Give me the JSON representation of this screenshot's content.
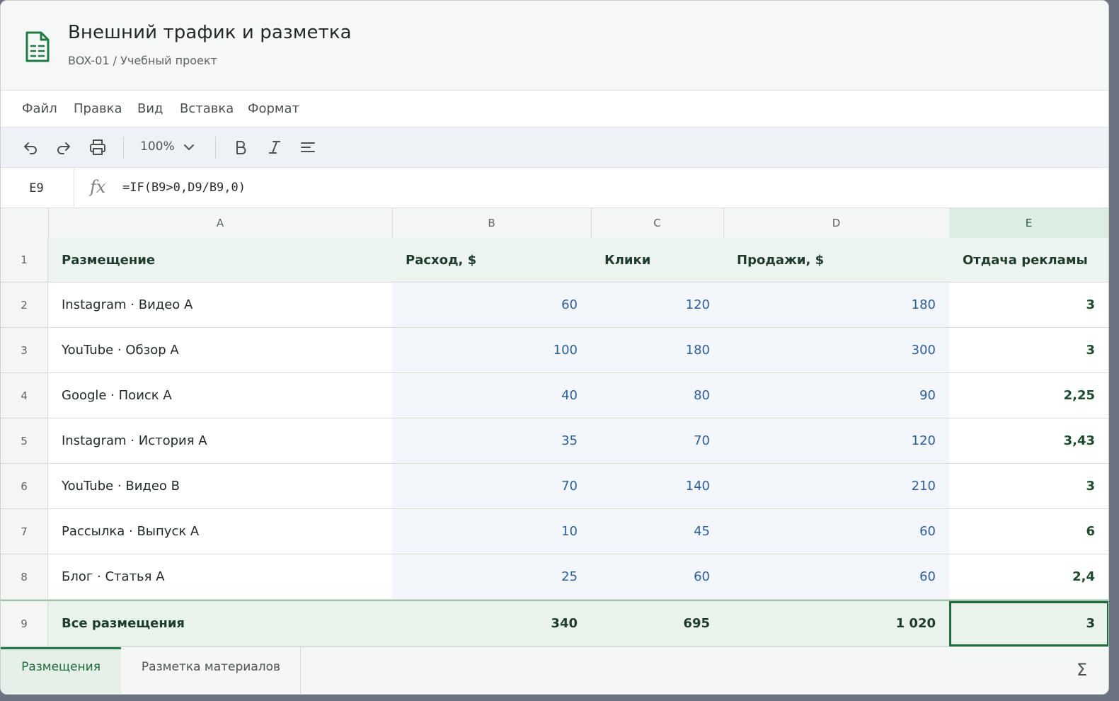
{
  "document": {
    "title": "Внешний трафик и разметка",
    "path": "BOX-01 / Учебный проект",
    "icon": "spreadsheet-doc-icon"
  },
  "menu": [
    "Файл",
    "Правка",
    "Вид",
    "Вставка",
    "Формат"
  ],
  "toolbar": {
    "zoom": "100%",
    "icons": [
      "undo-icon",
      "redo-icon",
      "print-icon",
      "chevron-down-icon",
      "bold-icon",
      "italic-icon",
      "align-icon"
    ]
  },
  "formula_bar": {
    "cell_ref": "E9",
    "fx_label": "fx",
    "formula": "=IF(B9>0,D9/B9,0)"
  },
  "grid": {
    "columns": [
      "A",
      "B",
      "C",
      "D",
      "E"
    ],
    "selected_column": "E",
    "header": {
      "row_num": "1",
      "cells": [
        "Размещение",
        "Расход, $",
        "Клики",
        "Продажи, $",
        "Отдача рекламы"
      ]
    },
    "rows": [
      {
        "row_num": "2",
        "placement": "Instagram · Видео A",
        "spend": "60",
        "clicks": "120",
        "sales": "180",
        "roas": "3"
      },
      {
        "row_num": "3",
        "placement": "YouTube · Обзор A",
        "spend": "100",
        "clicks": "180",
        "sales": "300",
        "roas": "3"
      },
      {
        "row_num": "4",
        "placement": "Google · Поиск A",
        "spend": "40",
        "clicks": "80",
        "sales": "90",
        "roas": "2,25"
      },
      {
        "row_num": "5",
        "placement": "Instagram · История A",
        "spend": "35",
        "clicks": "70",
        "sales": "120",
        "roas": "3,43"
      },
      {
        "row_num": "6",
        "placement": "YouTube · Видео B",
        "spend": "70",
        "clicks": "140",
        "sales": "210",
        "roas": "3"
      },
      {
        "row_num": "7",
        "placement": "Рассылка · Выпуск A",
        "spend": "10",
        "clicks": "45",
        "sales": "60",
        "roas": "6"
      },
      {
        "row_num": "8",
        "placement": "Блог · Статья A",
        "spend": "25",
        "clicks": "60",
        "sales": "60",
        "roas": "2,4"
      }
    ],
    "total": {
      "row_num": "9",
      "placement": "Все размещения",
      "spend": "340",
      "clicks": "695",
      "sales": "1 020",
      "roas": "3"
    },
    "selected_cell": "E9"
  },
  "sheets": {
    "tabs": [
      "Размещения",
      "Разметка материалов"
    ],
    "active": "Размещения",
    "sum_icon": "Σ"
  },
  "colors": {
    "accent": "#1f6b3d",
    "input_value": "#2d5e9c",
    "header_bg": "#ebf4ee",
    "selection_outline": "#1f6b3d"
  }
}
